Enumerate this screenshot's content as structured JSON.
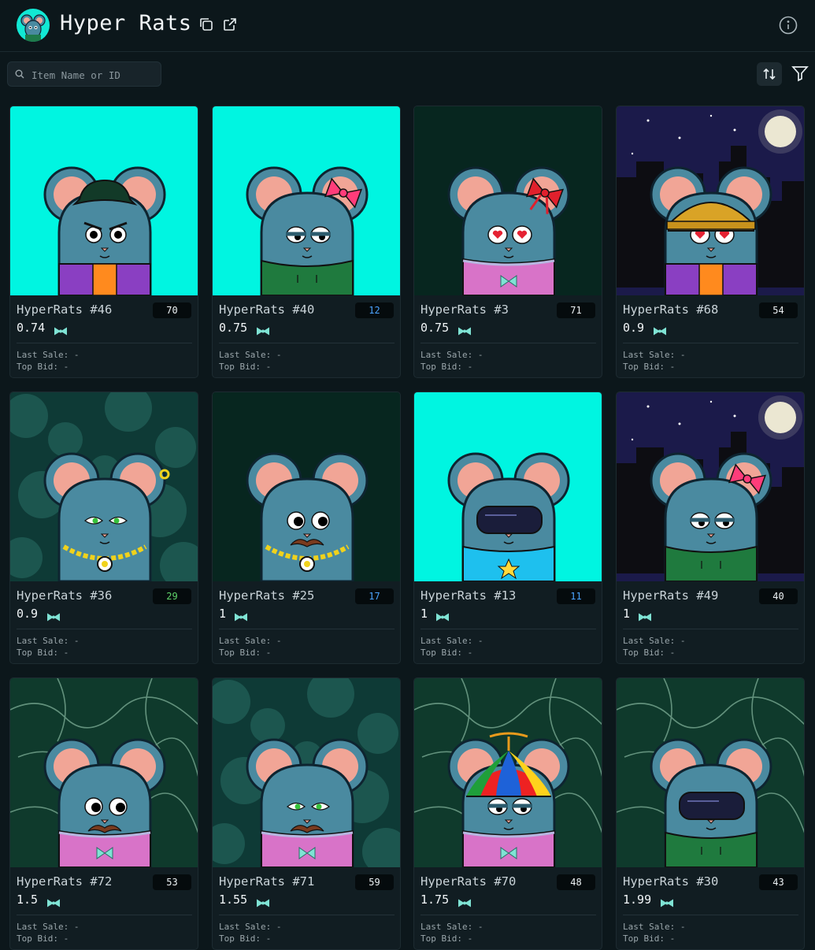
{
  "header": {
    "title": "Hyper Rats",
    "logo_icon": "rat-avatar-icon"
  },
  "search": {
    "placeholder": "Item Name or ID",
    "value": ""
  },
  "toolbar": {
    "sort_icon": "sort-arrows-icon",
    "filter_icon": "filter-funnel-icon",
    "info_icon": "info-circle-icon"
  },
  "labels": {
    "last_sale": "Last Sale:",
    "top_bid": "Top Bid:"
  },
  "colors": {
    "accent": "#7fe3d4",
    "rank_blue": "#4aa3ff",
    "rank_green": "#5fd36a"
  },
  "items": [
    {
      "name": "HyperRats #46",
      "rank": "70",
      "price": "0.74",
      "last_sale": "-",
      "top_bid": "-",
      "rank_color": "white",
      "bg": "cyan",
      "outfit": "purple-jacket",
      "hat": "cowboy",
      "eyes": "angry",
      "bow": false,
      "mustache": false
    },
    {
      "name": "HyperRats #40",
      "rank": "12",
      "price": "0.75",
      "last_sale": "-",
      "top_bid": "-",
      "rank_color": "blue",
      "bg": "cyan",
      "outfit": "green-hoodie",
      "hat": "ribbon",
      "eyes": "sleepy",
      "bow": false,
      "mustache": false
    },
    {
      "name": "HyperRats #3",
      "rank": "71",
      "price": "0.75",
      "last_sale": "-",
      "top_bid": "-",
      "rank_color": "white",
      "bg": "darkgreen",
      "outfit": "pink-sweater",
      "hat": "red-ribbon",
      "eyes": "hearts",
      "bow": true,
      "mustache": false
    },
    {
      "name": "HyperRats #68",
      "rank": "54",
      "price": "0.9",
      "last_sale": "-",
      "top_bid": "-",
      "rank_color": "white",
      "bg": "night",
      "outfit": "purple-jacket",
      "hat": "beanie",
      "eyes": "hearts",
      "bow": false,
      "mustache": false
    },
    {
      "name": "HyperRats #36",
      "rank": "29",
      "price": "0.9",
      "last_sale": "-",
      "top_bid": "-",
      "rank_color": "green",
      "bg": "bokeh",
      "outfit": "chain",
      "hat": "earring",
      "eyes": "green",
      "bow": false,
      "mustache": false
    },
    {
      "name": "HyperRats #25",
      "rank": "17",
      "price": "1",
      "last_sale": "-",
      "top_bid": "-",
      "rank_color": "blue",
      "bg": "darkgreen",
      "outfit": "chain",
      "hat": "none",
      "eyes": "round",
      "bow": false,
      "mustache": true
    },
    {
      "name": "HyperRats #13",
      "rank": "11",
      "price": "1",
      "last_sale": "-",
      "top_bid": "-",
      "rank_color": "blue",
      "bg": "cyan",
      "outfit": "blue-shirt",
      "hat": "visor",
      "eyes": "visor",
      "bow": false,
      "mustache": false
    },
    {
      "name": "HyperRats #49",
      "rank": "40",
      "price": "1",
      "last_sale": "-",
      "top_bid": "-",
      "rank_color": "white",
      "bg": "night",
      "outfit": "green-hoodie",
      "hat": "ribbon",
      "eyes": "sleepy",
      "bow": false,
      "mustache": false
    },
    {
      "name": "HyperRats #72",
      "rank": "53",
      "price": "1.5",
      "last_sale": "-",
      "top_bid": "-",
      "rank_color": "white",
      "bg": "caustic",
      "outfit": "pink-sweater",
      "hat": "none",
      "eyes": "round",
      "bow": true,
      "mustache": true
    },
    {
      "name": "HyperRats #71",
      "rank": "59",
      "price": "1.55",
      "last_sale": "-",
      "top_bid": "-",
      "rank_color": "white",
      "bg": "bokeh",
      "outfit": "pink-sweater",
      "hat": "none",
      "eyes": "green",
      "bow": true,
      "mustache": true
    },
    {
      "name": "HyperRats #70",
      "rank": "48",
      "price": "1.75",
      "last_sale": "-",
      "top_bid": "-",
      "rank_color": "white",
      "bg": "caustic",
      "outfit": "pink-sweater",
      "hat": "propeller",
      "eyes": "sleepy",
      "bow": true,
      "mustache": false
    },
    {
      "name": "HyperRats #30",
      "rank": "43",
      "price": "1.99",
      "last_sale": "-",
      "top_bid": "-",
      "rank_color": "white",
      "bg": "caustic",
      "outfit": "green-hoodie",
      "hat": "visor",
      "eyes": "visor",
      "bow": false,
      "mustache": false
    }
  ]
}
